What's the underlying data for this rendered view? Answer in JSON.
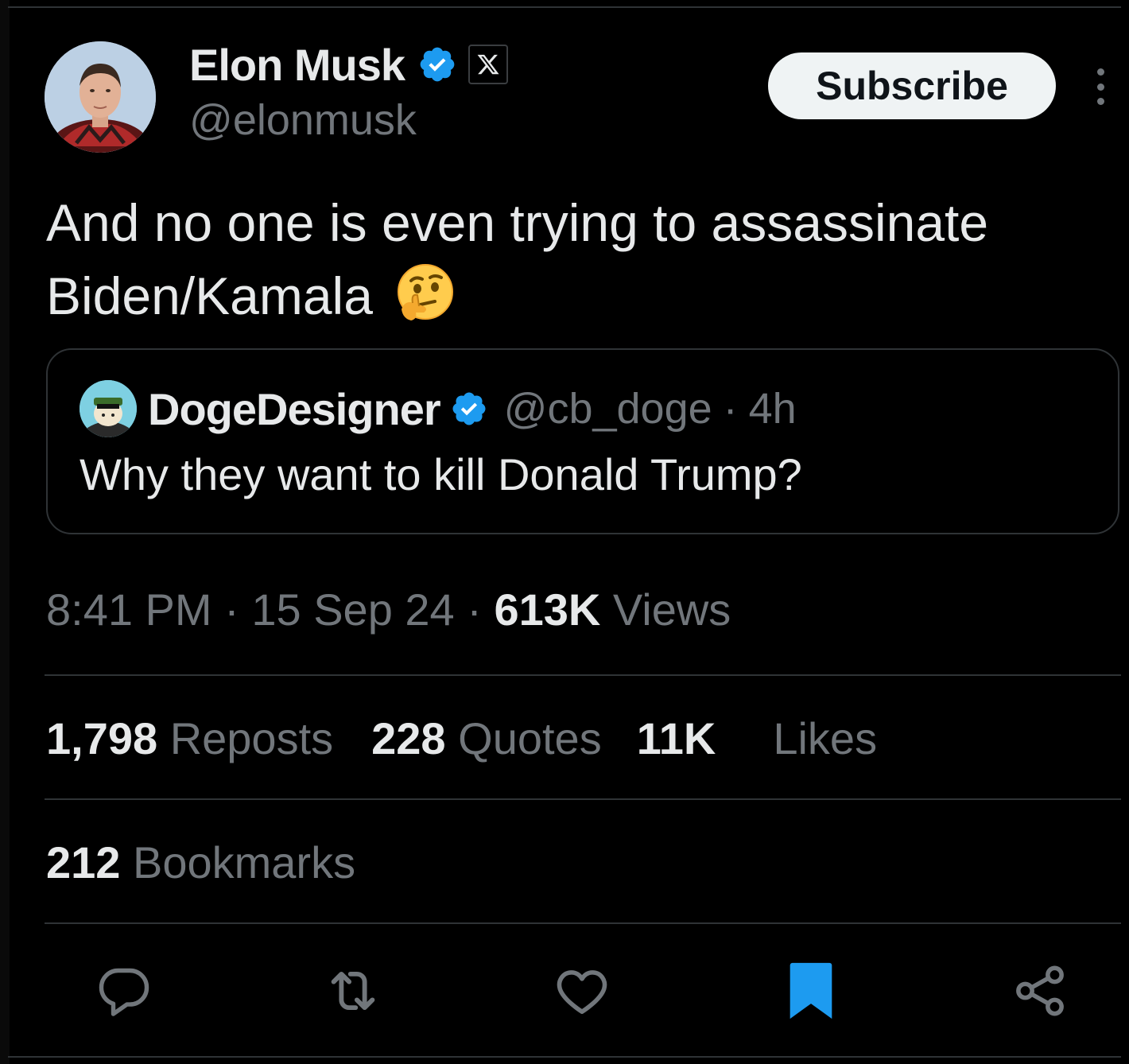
{
  "author": {
    "name": "Elon Musk",
    "handle": "@elonmusk",
    "verified": true,
    "affiliation_badge": "x-logo-icon"
  },
  "header": {
    "subscribe_label": "Subscribe",
    "more_icon": "more-vertical-icon"
  },
  "tweet": {
    "text_line1": "And no one is even trying to assassinate",
    "text_line2": "Biden/Kamala",
    "emoji": "thinking-face-emoji"
  },
  "quote": {
    "name": "DogeDesigner",
    "handle": "@cb_doge",
    "separator": "·",
    "time": "4h",
    "text": "Why they want to kill Donald Trump?"
  },
  "meta": {
    "time": "8:41 PM",
    "date": "15 Sep 24",
    "separator": "·",
    "views_count": "613K",
    "views_label": "Views"
  },
  "stats": {
    "reposts_count": "1,798",
    "reposts_label": "Reposts",
    "quotes_count": "228",
    "quotes_label": "Quotes",
    "likes_count": "11K",
    "likes_label": "Likes",
    "bookmarks_count": "212",
    "bookmarks_label": "Bookmarks"
  },
  "actions": [
    {
      "name": "reply-icon"
    },
    {
      "name": "repost-icon"
    },
    {
      "name": "like-icon"
    },
    {
      "name": "bookmark-icon",
      "active": true
    },
    {
      "name": "share-icon"
    }
  ],
  "colors": {
    "background": "#000000",
    "primary_text": "#e7e9ea",
    "secondary_text": "#71767b",
    "divider": "#2f3336",
    "verified_blue": "#1d9bf0",
    "subscribe_bg": "#eff3f4"
  }
}
